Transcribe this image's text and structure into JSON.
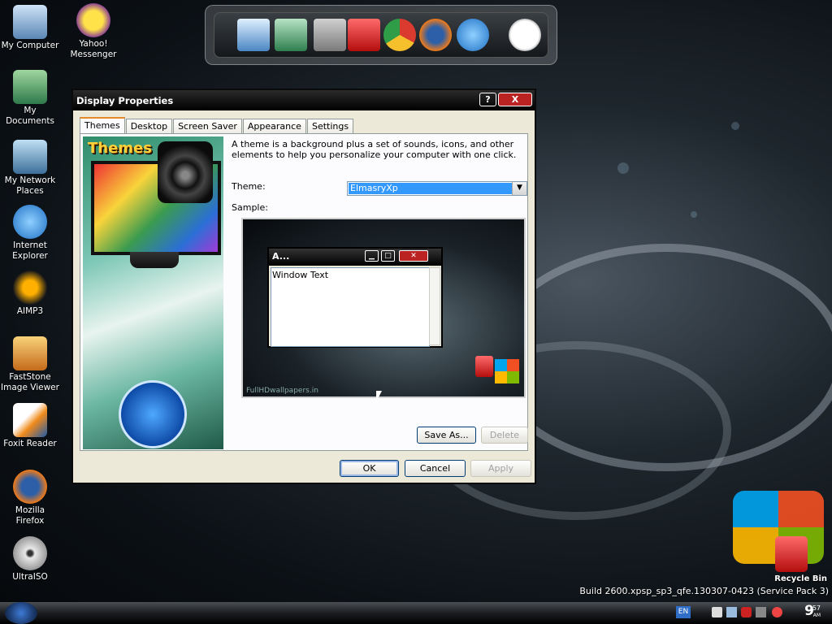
{
  "desktop": {
    "icons": [
      {
        "label": "My Computer"
      },
      {
        "label": "My Documents"
      },
      {
        "label": "My Network Places"
      },
      {
        "label": "Internet Explorer"
      },
      {
        "label": "AIMP3"
      },
      {
        "label": "FastStone Image Viewer"
      },
      {
        "label": "Foxit Reader"
      },
      {
        "label": "Mozilla Firefox"
      },
      {
        "label": "UltraISO"
      },
      {
        "label": "Yahoo! Messenger"
      }
    ],
    "recycle_label": "Recycle Bin",
    "build_text": "Build 2600.xpsp_sp3_qfe.130307-0423 (Service Pack 3)"
  },
  "window": {
    "title": "Display Properties",
    "help_btn": "?",
    "close_btn": "X",
    "tabs": [
      {
        "label": "Themes",
        "active": true
      },
      {
        "label": "Desktop"
      },
      {
        "label": "Screen Saver"
      },
      {
        "label": "Appearance"
      },
      {
        "label": "Settings"
      }
    ],
    "sidebar_title": "Themes",
    "description": "A theme is a background plus a set of sounds, icons, and other elements to help you personalize your computer with one click.",
    "theme_label": "Theme:",
    "theme_value": "ElmasryXp",
    "sample_label": "Sample:",
    "sample": {
      "mini_title": "A...",
      "window_text": "Window Text",
      "watermark": "FullHDwallpapers.in"
    },
    "buttons": {
      "save_as": "Save As...",
      "delete": "Delete",
      "ok": "OK",
      "cancel": "Cancel",
      "apply": "Apply"
    }
  },
  "taskbar": {
    "language": "EN",
    "clock_hour": "9",
    "clock_min": "57",
    "clock_ampm": "AM"
  },
  "colors": {
    "title_bar": "#000000",
    "selection": "#3399ff",
    "active_tab_accent": "#e68b2c"
  }
}
